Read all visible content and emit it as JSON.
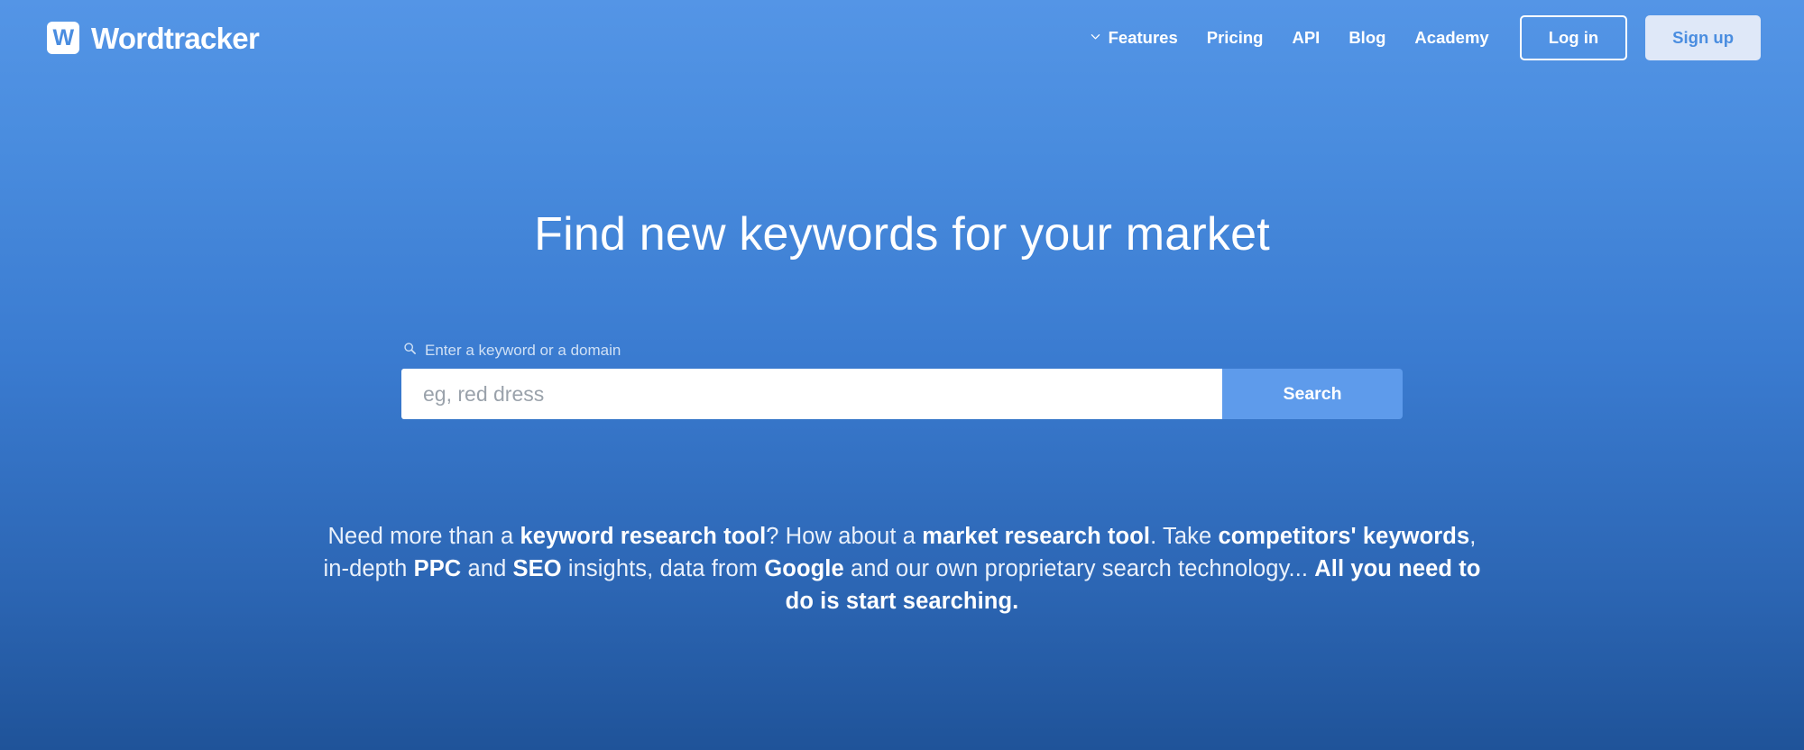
{
  "brand": {
    "mark_letter": "W",
    "name": "Wordtracker"
  },
  "nav": {
    "items": [
      {
        "label": "Features",
        "has_chevron": true,
        "icon": "chevron-down-icon"
      },
      {
        "label": "Pricing",
        "has_chevron": false
      },
      {
        "label": "API",
        "has_chevron": false
      },
      {
        "label": "Blog",
        "has_chevron": false
      },
      {
        "label": "Academy",
        "has_chevron": false
      }
    ],
    "login_label": "Log in",
    "signup_label": "Sign up"
  },
  "hero": {
    "headline": "Find new keywords for your market"
  },
  "search": {
    "icon": "search-icon",
    "label": "Enter a keyword or a domain",
    "value": "",
    "placeholder": "eg, red dress",
    "button_label": "Search"
  },
  "subcopy": {
    "parts": [
      {
        "text": "Need more than a ",
        "bold": false
      },
      {
        "text": "keyword research tool",
        "bold": true
      },
      {
        "text": "? How about a ",
        "bold": false
      },
      {
        "text": "market research tool",
        "bold": true
      },
      {
        "text": ". Take ",
        "bold": false
      },
      {
        "text": "competitors' keywords",
        "bold": true
      },
      {
        "text": ", in-depth ",
        "bold": false
      },
      {
        "text": "PPC",
        "bold": true
      },
      {
        "text": " and ",
        "bold": false
      },
      {
        "text": "SEO",
        "bold": true
      },
      {
        "text": " insights, data from ",
        "bold": false
      },
      {
        "text": "Google",
        "bold": true
      },
      {
        "text": " and our own proprietary search technology... ",
        "bold": false
      },
      {
        "text": "All you need to do is start searching.",
        "bold": true
      }
    ]
  },
  "colors": {
    "bg_top": "#5495e6",
    "bg_bottom": "#1f5399",
    "brand_blue": "#4a8de0",
    "search_button": "#5e9beb",
    "signup_bg": "#dfe8f8",
    "label_text": "#cfe0f5"
  }
}
